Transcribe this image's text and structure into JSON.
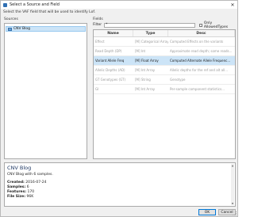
{
  "window": {
    "title": "Select a Source and Field",
    "minimize_glyph": "—",
    "close_glyph": "✕"
  },
  "instruction": "Select the VAF field that will be used to identify Lof.",
  "sources": {
    "label": "Sources",
    "items": [
      {
        "label": "CNV Blog",
        "icon": "database-icon",
        "selected": true
      }
    ]
  },
  "fields": {
    "label": "Fields",
    "filter_label": "Filter",
    "filter_value": "*",
    "only_allowed_label": "Only AllowedTypes",
    "columns": [
      "Name",
      "Type",
      "Desc"
    ],
    "rows": [
      {
        "name": "Effect",
        "type": "[M] Categorical Array",
        "desc": "Computed Effects on the variants",
        "selected": false
      },
      {
        "name": "Read Depth (DP)",
        "type": "[M] Int",
        "desc": "Approximate read depth; some reads...",
        "selected": false
      },
      {
        "name": "Variant Allele Freq",
        "type": "[M] Float Array",
        "desc": "Computed Alternate Allele Frequenc...",
        "selected": true
      },
      {
        "name": "Allelic Depths (AD)",
        "type": "[M] Int Array",
        "desc": "Allelic depths for the ref and alt all...",
        "selected": false
      },
      {
        "name": "GT Genotypes (GT)",
        "type": "[M] String",
        "desc": "Genotype",
        "selected": false
      },
      {
        "name": "GI",
        "type": "[M] Int Array",
        "desc": "Per-sample component statistics...",
        "selected": false
      }
    ]
  },
  "info": {
    "title": "CNV Blog",
    "description": "CNV Blog with 6 samples.",
    "created_label": "Created:",
    "created_value": "2016-07-24",
    "samples_label": "Samples:",
    "samples_value": "6",
    "features_label": "Features:",
    "features_value": "170",
    "filesize_label": "File Size:",
    "filesize_value": "96K"
  },
  "buttons": {
    "ok": "OK",
    "cancel": "Cancel"
  }
}
